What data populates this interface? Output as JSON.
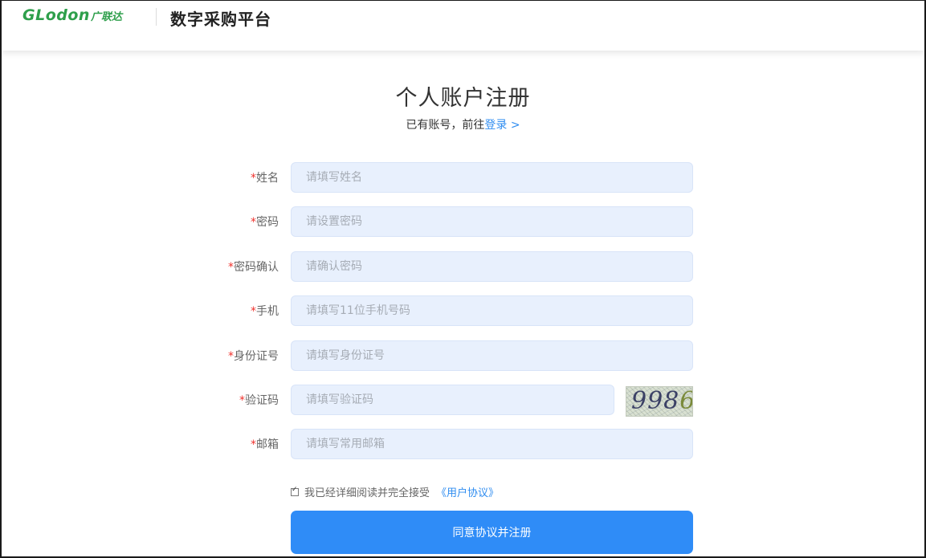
{
  "header": {
    "logo_en": "GLodon",
    "logo_cn": "广联达",
    "platform_title": "数字采购平台"
  },
  "page": {
    "title": "个人账户注册",
    "login_hint": "已有账号，前往",
    "login_link": "登录 >"
  },
  "form": {
    "required_mark": "*",
    "fields": [
      {
        "label": "姓名",
        "placeholder": "请填写姓名"
      },
      {
        "label": "密码",
        "placeholder": "请设置密码"
      },
      {
        "label": "密码确认",
        "placeholder": "请确认密码"
      },
      {
        "label": "手机",
        "placeholder": "请填写11位手机号码"
      },
      {
        "label": "身份证号",
        "placeholder": "请填写身份证号"
      },
      {
        "label": "验证码",
        "placeholder": "请填写验证码"
      },
      {
        "label": "邮箱",
        "placeholder": "请填写常用邮箱"
      }
    ],
    "captcha_text": "998",
    "captcha_last": "6"
  },
  "agreement": {
    "checked": true,
    "text": "我已经详细阅读并完全接受",
    "link": "《用户协议》"
  },
  "submit_label": "同意协议并注册",
  "colors": {
    "brand_green": "#2e9f4b",
    "link_blue": "#2e8cf0",
    "button_blue": "#2f8cf7",
    "input_bg": "#e8f0fd",
    "required_red": "#f0322d"
  }
}
